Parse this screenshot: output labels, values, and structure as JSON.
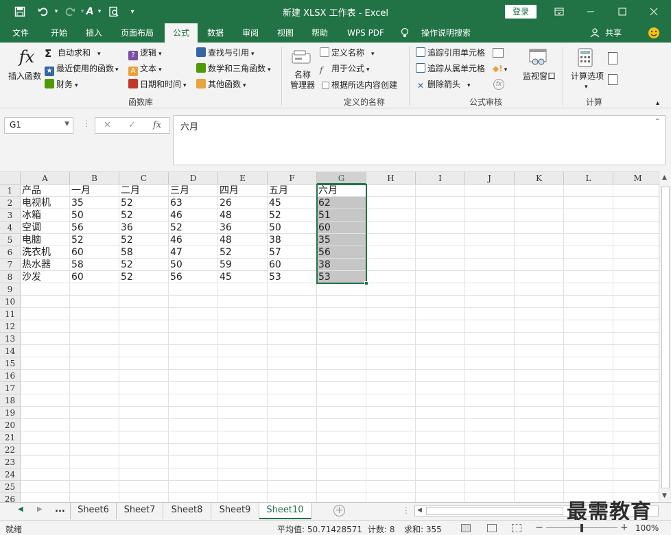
{
  "window": {
    "title": "新建 XLSX 工作表 - Excel",
    "login_label": "登录",
    "brand_color": "#217346"
  },
  "quick_access": {
    "save_icon": "save-icon",
    "undo_icon": "undo-icon",
    "redo_icon": "redo-icon",
    "font_color_glyph": "A",
    "preview_icon": "print-preview-icon"
  },
  "tabs": [
    "文件",
    "开始",
    "插入",
    "页面布局",
    "公式",
    "数据",
    "审阅",
    "视图",
    "帮助",
    "WPS PDF",
    "操作说明搜索"
  ],
  "active_tab": "公式",
  "share_label": "共享",
  "ribbon": {
    "insert_function": "插入函数",
    "fx_glyph": "fx",
    "autosum": "自动求和",
    "recent": "最近使用的函数",
    "finance": "财务",
    "logical": "逻辑",
    "text": "文本",
    "datetime": "日期和时间",
    "lookup": "查找与引用",
    "math": "数学和三角函数",
    "other": "其他函数",
    "group_library": "函数库",
    "name_manager_l1": "名称",
    "name_manager_l2": "管理器",
    "define_name": "定义名称",
    "use_in_formula": "用于公式",
    "create_from_selection": "根据所选内容创建",
    "group_names": "定义的名称",
    "trace_precedents": "追踪引用单元格",
    "trace_dependents": "追踪从属单元格",
    "remove_arrows": "删除箭头",
    "watch_window": "监视窗口",
    "group_audit": "公式审核",
    "calc_options": "计算选项",
    "group_calc": "计算"
  },
  "formula_bar": {
    "name_box": "G1",
    "fx_label": "fx",
    "content": "六月"
  },
  "columns": [
    "A",
    "B",
    "C",
    "D",
    "E",
    "F",
    "G",
    "H",
    "I",
    "J",
    "K",
    "L",
    "M"
  ],
  "selected_column": "G",
  "rows": [
    [
      "产品",
      "一月",
      "二月",
      "三月",
      "四月",
      "五月",
      "六月"
    ],
    [
      "电视机",
      "35",
      "52",
      "63",
      "26",
      "45",
      "62"
    ],
    [
      "冰箱",
      "50",
      "52",
      "46",
      "48",
      "52",
      "51"
    ],
    [
      "空调",
      "56",
      "36",
      "52",
      "36",
      "50",
      "60"
    ],
    [
      "电脑",
      "52",
      "52",
      "46",
      "48",
      "38",
      "35"
    ],
    [
      "洗衣机",
      "60",
      "58",
      "47",
      "52",
      "57",
      "56"
    ],
    [
      "热水器",
      "58",
      "52",
      "50",
      "59",
      "60",
      "38"
    ],
    [
      "沙发",
      "60",
      "52",
      "56",
      "45",
      "53",
      "53"
    ]
  ],
  "row_numbers": [
    "1",
    "2",
    "3",
    "4",
    "5",
    "6",
    "7",
    "8",
    "9",
    "10",
    "11",
    "12",
    "13",
    "14",
    "15",
    "16",
    "17",
    "18",
    "19",
    "20",
    "21",
    "22",
    "23",
    "24",
    "25",
    "26"
  ],
  "sheets": [
    "Sheet6",
    "Sheet7",
    "Sheet8",
    "Sheet9",
    "Sheet10"
  ],
  "active_sheet": "Sheet10",
  "sheet_nav_more": "...",
  "watermark": "最需教育",
  "status": {
    "ready": "就绪",
    "average": "平均值: 50.71428571",
    "count": "计数: 8",
    "sum": "求和: 355",
    "zoom": "100%"
  }
}
